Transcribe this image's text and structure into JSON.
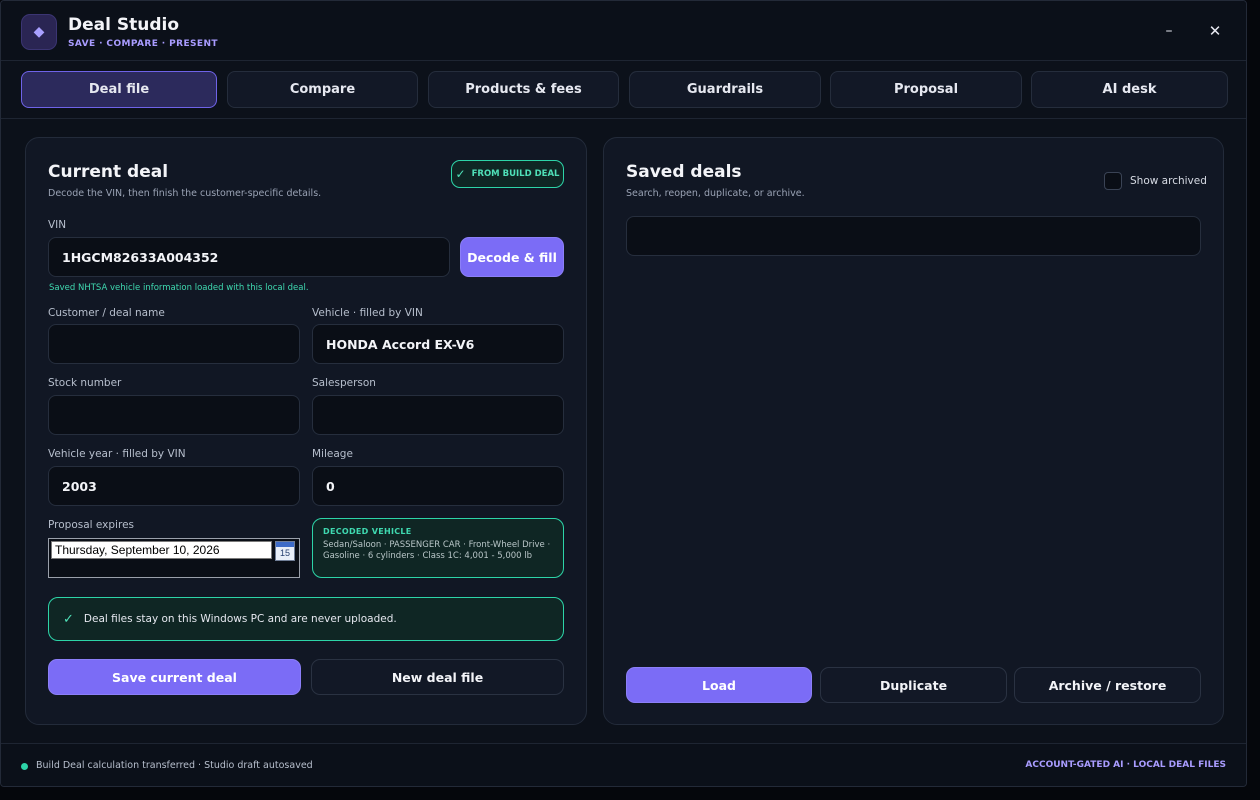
{
  "app": {
    "title": "Deal Studio",
    "subtitle": "SAVE · COMPARE · PRESENT",
    "logo_icon": "diamond-icon",
    "minimize_glyph": "–",
    "close_glyph": "✕"
  },
  "tabs": [
    {
      "label": "Deal file",
      "active": true
    },
    {
      "label": "Compare",
      "active": false
    },
    {
      "label": "Products & fees",
      "active": false
    },
    {
      "label": "Guardrails",
      "active": false
    },
    {
      "label": "Proposal",
      "active": false
    },
    {
      "label": "AI desk",
      "active": false
    }
  ],
  "current_deal": {
    "title": "Current deal",
    "description": "Decode the VIN, then finish the customer-specific details.",
    "badge": "FROM BUILD DEAL",
    "vin_label": "VIN",
    "vin_value": "1HGCM82633A004352",
    "decode_button": "Decode & fill",
    "vin_note": "Saved NHTSA vehicle information loaded with this local deal.",
    "customer_label": "Customer / deal name",
    "customer_value": "",
    "vehicle_label": "Vehicle · filled by VIN",
    "vehicle_value": "HONDA Accord EX-V6",
    "stock_label": "Stock number",
    "stock_value": "",
    "salesperson_label": "Salesperson",
    "salesperson_value": "",
    "year_label": "Vehicle year · filled by VIN",
    "year_value": "2003",
    "mileage_label": "Mileage",
    "mileage_value": "0",
    "expires_label": "Proposal expires",
    "expires_value": "Thursday, September 10, 2026",
    "calendar_day": "15",
    "decoded_title": "DECODED VEHICLE",
    "decoded_line1": "Sedan/Saloon  ·  PASSENGER CAR  ·  Front-Wheel Drive  ·",
    "decoded_line2": "Gasoline  ·  6 cylinders  ·  Class 1C: 4,001 - 5,000 lb",
    "notice": "Deal files stay on this Windows PC and are never uploaded.",
    "save_button": "Save current deal",
    "new_button": "New deal file"
  },
  "saved_deals": {
    "title": "Saved deals",
    "description": "Search, reopen, duplicate, or archive.",
    "show_archived_label": "Show archived",
    "show_archived_checked": false,
    "load_button": "Load",
    "duplicate_button": "Duplicate",
    "archive_button": "Archive / restore"
  },
  "status": {
    "text": "Build Deal calculation transferred · Studio draft autosaved",
    "right": "ACCOUNT-GATED AI · LOCAL DEAL FILES",
    "dot_color": "#2dd4a8"
  },
  "colors": {
    "accent": "#7b6cf6",
    "success": "#2dd4a8",
    "background": "#0c111a"
  }
}
